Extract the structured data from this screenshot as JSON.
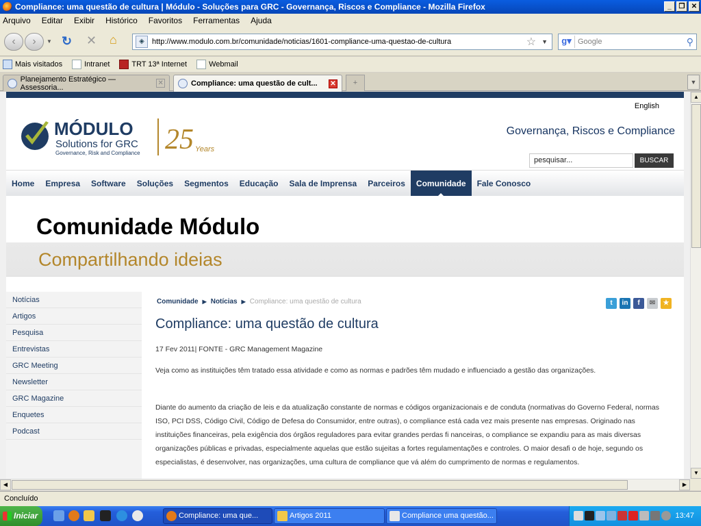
{
  "window": {
    "title": "Compliance: uma questão de cultura | Módulo - Soluções para GRC - Governança, Riscos e Compliance - Mozilla Firefox",
    "controls": [
      "_",
      "❐",
      "✕"
    ]
  },
  "menu": [
    "Arquivo",
    "Editar",
    "Exibir",
    "Histórico",
    "Favoritos",
    "Ferramentas",
    "Ajuda"
  ],
  "navigation": {
    "url": "http://www.modulo.com.br/comunidade/noticias/1601-compliance-uma-questao-de-cultura",
    "search_placeholder": "Google"
  },
  "bookmarks": [
    "Mais visitados",
    "Intranet",
    "TRT 13ª Internet",
    "Webmail"
  ],
  "tabs": [
    {
      "label": "Planejamento Estratégico — Assessoria..."
    },
    {
      "label": "Compliance: uma questão de cult..."
    }
  ],
  "site": {
    "language_link": "English",
    "logo_name": "MÓDULO",
    "logo_sub": "Solutions for GRC",
    "logo_sub2": "Governance, Risk and Compliance",
    "logo_years": "25",
    "logo_years_label": "Years",
    "tagline": "Governança, Riscos e Compliance",
    "search_value": "pesquisar...",
    "search_button": "BUSCAR",
    "nav": [
      "Home",
      "Empresa",
      "Software",
      "Soluções",
      "Segmentos",
      "Educação",
      "Sala de Imprensa",
      "Parceiros",
      "Comunidade",
      "Fale Conosco"
    ],
    "nav_active": "Comunidade",
    "banner_title": "Comunidade Módulo",
    "banner_subtitle": "Compartilhando ideias",
    "sidebar": [
      "Notícias",
      "Artigos",
      "Pesquisa",
      "Entrevistas",
      "GRC Meeting",
      "Newsletter",
      "GRC Magazine",
      "Enquetes",
      "Podcast"
    ],
    "breadcrumb": [
      "Comunidade",
      "Notícias",
      "Compliance: uma questão de cultura"
    ],
    "article": {
      "title": "Compliance: uma questão de cultura",
      "date_source": "17 Fev 2011| FONTE - GRC Management Magazine",
      "lead": "Veja como as instituições têm tratado essa atividade e como as normas e padrões têm mudado e influenciado a gestão das organizações.",
      "body": " Diante do aumento da criação de leis e da atualização constante de normas e códigos organizacionais e de conduta (normativas do Governo Federal, normas ISO, PCI DSS, Código Civil, Código de Defesa do Consumidor, entre outras), o compliance está cada vez mais presente nas empresas. Originado nas instituições financeiras, pela exigência dos órgãos reguladores para evitar grandes perdas fi nanceiras, o compliance se expandiu para as mais diversas organizações públicas e privadas, especialmente aquelas que estão sujeitas a fortes regulamentações e controles. O maior desafi o de hoje, segundo os especialistas, é desenvolver, nas organizações, uma cultura de compliance que vá além do cumprimento de normas e regulamentos."
    }
  },
  "status": "Concluído",
  "taskbar": {
    "start": "Iniciar",
    "tasks": [
      "Compliance: uma que...",
      "Artigos 2011",
      "Compliance uma questão..."
    ],
    "clock": "13:47"
  }
}
